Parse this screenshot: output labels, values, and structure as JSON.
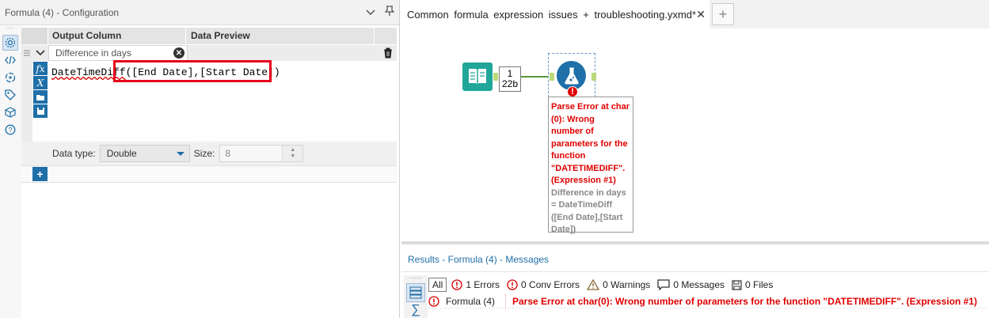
{
  "config": {
    "title": "Formula (4) - Configuration",
    "columns": {
      "output": "Output Column",
      "preview": "Data Preview"
    },
    "row": {
      "output_value": "Difference in days"
    },
    "expression": {
      "fn": "DateTimeDiff",
      "args": "([End Date],[Start Date])"
    },
    "data_type_label": "Data type:",
    "data_type_value": "Double",
    "size_label": "Size:",
    "size_value": "8"
  },
  "canvas": {
    "tab_title": "Common formula expression issues + troubleshooting.yxmd*",
    "tab_close": "✕",
    "new_tab": "+",
    "record_count": {
      "records": "1",
      "size": "22b"
    },
    "annotation": {
      "error_lines": [
        "Parse Error at char",
        "(0): Wrong",
        "number of",
        "parameters for the",
        "function",
        "\"DATETIMEDIFF\".",
        "(Expression #1)"
      ],
      "expr_lines": [
        "Difference in days",
        "= DateTimeDiff",
        "([End Date],[Start",
        "Date])"
      ]
    }
  },
  "results": {
    "title": "Results - Formula (4) - Messages",
    "filter_all": "All",
    "errors": "1 Errors",
    "conv_errors": "0 Conv Errors",
    "warnings": "0 Warnings",
    "messages": "0 Messages",
    "files": "0 Files",
    "message": {
      "tool": "Formula (4)",
      "text": "Parse Error at char(0): Wrong number of parameters for the function \"DATETIMEDIFF\". (Expression #1)"
    }
  },
  "colors": {
    "accent": "#1f6fa8",
    "error": "#e00000",
    "input_tool": "#21a69a",
    "highlight_box": "#e4001b"
  }
}
